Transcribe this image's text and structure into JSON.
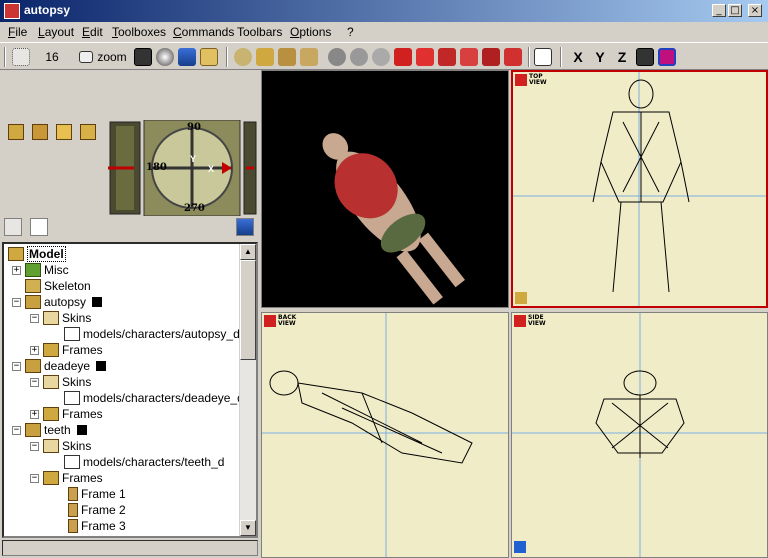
{
  "window": {
    "title": "autopsy",
    "min": "_",
    "max": "□",
    "close": "×"
  },
  "menu": [
    {
      "label": "File",
      "u": "F",
      "rest": "ile"
    },
    {
      "label": "Layout",
      "u": "L",
      "rest": "ayout"
    },
    {
      "label": "Edit",
      "u": "E",
      "rest": "dit"
    },
    {
      "label": "Toolboxes",
      "u": "T",
      "rest": "oolboxes"
    },
    {
      "label": "Commands",
      "u": "C",
      "rest": "ommands"
    },
    {
      "label": "Toolbars",
      "u": "",
      "rest": "Toolbars"
    },
    {
      "label": "Options",
      "u": "O",
      "rest": "ptions"
    },
    {
      "label": "?",
      "u": "",
      "rest": "?"
    }
  ],
  "toolbar": {
    "grid_value": "16",
    "zoom_label": "zoom",
    "x": "X",
    "y": "Y",
    "z": "Z"
  },
  "compass": {
    "top": "90",
    "left": "180",
    "bottom": "270",
    "cy": "Y",
    "cx": "X"
  },
  "tree": {
    "root": "Model",
    "items": [
      {
        "label": "Misc"
      },
      {
        "label": "Skeleton"
      },
      {
        "label": "autopsy"
      },
      {
        "label": "Skins"
      },
      {
        "label": "models/characters/autopsy_d"
      },
      {
        "label": "Frames"
      },
      {
        "label": "deadeye"
      },
      {
        "label": "Skins"
      },
      {
        "label": "models/characters/deadeye_d"
      },
      {
        "label": "Frames"
      },
      {
        "label": "teeth"
      },
      {
        "label": "Skins"
      },
      {
        "label": "models/characters/teeth_d"
      },
      {
        "label": "Frames"
      },
      {
        "label": "Frame 1"
      },
      {
        "label": "Frame 2"
      },
      {
        "label": "Frame 3"
      }
    ]
  },
  "viewports": {
    "top": {
      "line1": "TOP",
      "line2": "VIEW"
    },
    "back": {
      "line1": "BACK",
      "line2": "VIEW"
    },
    "side": {
      "line1": "SIDE",
      "line2": "VIEW"
    }
  },
  "colors": {
    "title_start": "#0a246a",
    "title_end": "#a6caf0",
    "viewport_bg": "#f0ecc8",
    "grid_line": "#7ab0e0",
    "active_border": "#c00000"
  }
}
